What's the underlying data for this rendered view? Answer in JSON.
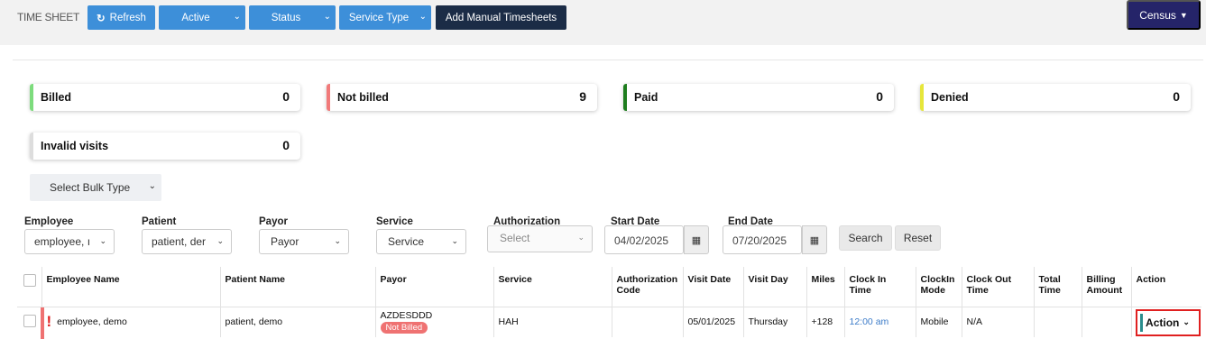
{
  "header": {
    "title": "TIME SHEET",
    "refresh_label": "Refresh",
    "active_label": "Active",
    "status_label": "Status",
    "service_type_label": "Service Type",
    "add_manual_label": "Add Manual Timesheets",
    "census_label": "Census"
  },
  "summary": [
    {
      "label": "Billed",
      "count": "0",
      "color": "#7ddc7d"
    },
    {
      "label": "Not billed",
      "count": "9",
      "color": "#f17a7a"
    },
    {
      "label": "Paid",
      "count": "0",
      "color": "#1e7d1e"
    },
    {
      "label": "Denied",
      "count": "0",
      "color": "#e6e63b"
    },
    {
      "label": "Invalid visits",
      "count": "0",
      "color": "#dddddd"
    }
  ],
  "bulk": {
    "label": "Select Bulk Type"
  },
  "filters": {
    "employee": {
      "label": "Employee",
      "value": "employee, ı"
    },
    "patient": {
      "label": "Patient",
      "value": "patient, der"
    },
    "payor": {
      "label": "Payor",
      "value": "Payor"
    },
    "service": {
      "label": "Service",
      "value": "Service"
    },
    "authorization": {
      "label": "Authorization",
      "value": "Select"
    },
    "start_date": {
      "label": "Start Date",
      "value": "04/02/2025"
    },
    "end_date": {
      "label": "End Date",
      "value": "07/20/2025"
    },
    "search_label": "Search",
    "reset_label": "Reset"
  },
  "table": {
    "headers": {
      "employee_name": "Employee Name",
      "patient_name": "Patient Name",
      "payor": "Payor",
      "service": "Service",
      "authorization_code": "Authorization Code",
      "visit_date": "Visit Date",
      "visit_day": "Visit Day",
      "miles": "Miles",
      "clock_in_time": "Clock In Time",
      "clockin_mode": "ClockIn Mode",
      "clock_out_time": "Clock Out Time",
      "total_time": "Total Time",
      "billing_amount": "Billing Amount",
      "action": "Action"
    },
    "rows": [
      {
        "employee_name": "employee, demo",
        "patient_name": "patient, demo",
        "payor": "AZDESDDD",
        "status_badge": "Not Billed",
        "service": "HAH",
        "authorization_code": "",
        "visit_date": "05/01/2025",
        "visit_day": "Thursday",
        "miles": "+128",
        "clock_in_time": "12:00 am",
        "clockin_mode": "Mobile",
        "clock_out_time": "N/A",
        "total_time": "",
        "billing_amount": "",
        "action_label": "Action"
      }
    ]
  }
}
